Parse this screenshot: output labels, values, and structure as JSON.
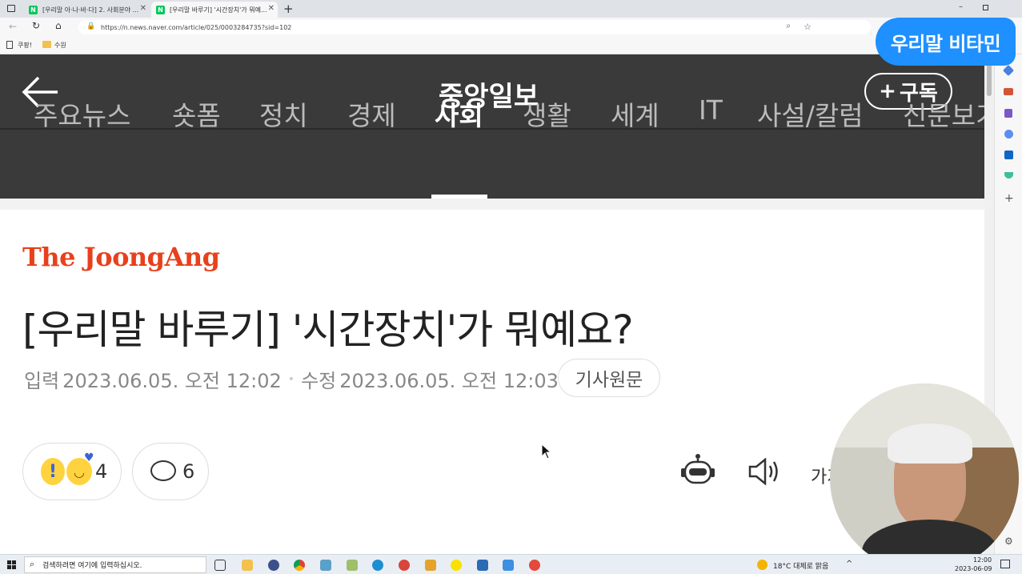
{
  "browser": {
    "tabs": [
      {
        "label": "[우리말 아·나·바·다] 2. 사회분야 ...",
        "favicon": "N"
      },
      {
        "label": "[우리말 바루기] '시간장치'가 뭐예...",
        "favicon": "N"
      }
    ],
    "url": "https://n.news.naver.com/article/025/0003284735?sid=102",
    "bookmarks": [
      "쿠팡!",
      "수원"
    ]
  },
  "overlay_banner": {
    "text": "우리말 비타민"
  },
  "header": {
    "title": "중앙일보",
    "subscribe_label": "구독"
  },
  "categories": [
    {
      "label": "주요뉴스",
      "active": false
    },
    {
      "label": "숏폼",
      "active": false
    },
    {
      "label": "정치",
      "active": false
    },
    {
      "label": "경제",
      "active": false
    },
    {
      "label": "사회",
      "active": true
    },
    {
      "label": "생활",
      "active": false
    },
    {
      "label": "세계",
      "active": false
    },
    {
      "label": "IT",
      "active": false
    },
    {
      "label": "사설/칼럼",
      "active": false
    },
    {
      "label": "신문보기",
      "active": false
    }
  ],
  "article": {
    "publisher_logo": "The JoongAng",
    "title": "[우리말 바루기] '시간장치'가 뭐예요?",
    "input_label": "입력",
    "input_date": "2023.06.05. 오전 12:02",
    "edit_label": "수정",
    "edit_date": "2023.06.05. 오전 12:03",
    "original_button": "기사원문",
    "reaction_count": "4",
    "comment_count": "6",
    "font_size_label": "가가"
  },
  "taskbar": {
    "search_placeholder": "검색하려면 여기에 입력하십시오.",
    "weather": "18°C  대체로 맑음",
    "time": "12:00",
    "date": "2023-06-09"
  },
  "colors": {
    "nav_bg": "#3a3a3a",
    "logo_red": "#e8401c",
    "banner_blue": "#1e90ff"
  }
}
